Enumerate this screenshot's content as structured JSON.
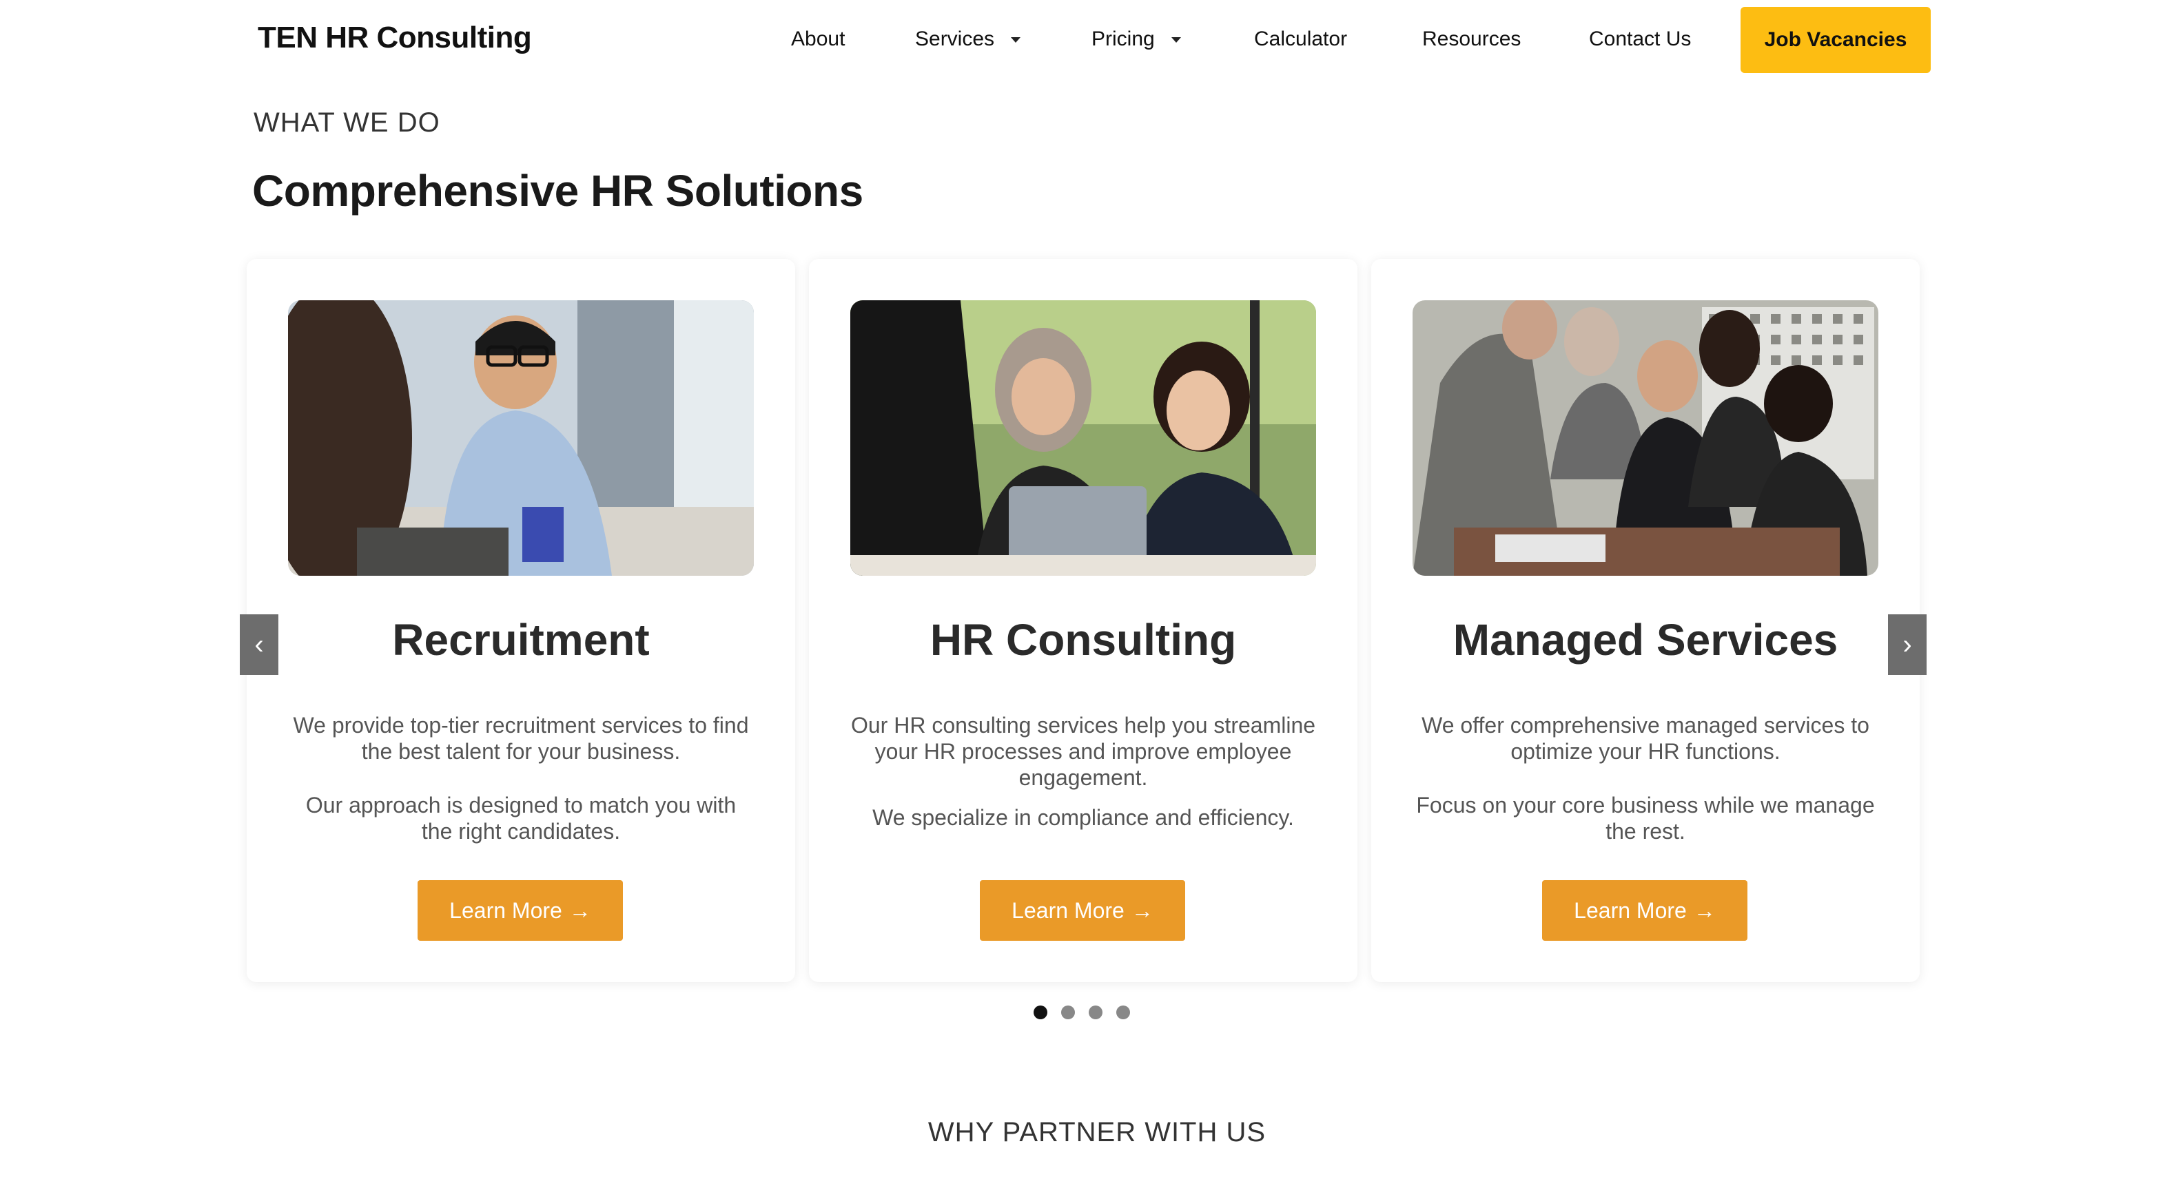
{
  "brand": "TEN HR Consulting",
  "nav": {
    "about": "About",
    "services": "Services",
    "pricing": "Pricing",
    "calculator": "Calculator",
    "resources": "Resources",
    "contact": "Contact Us",
    "job_vacancies": "Job Vacancies"
  },
  "section": {
    "eyebrow": "WHAT WE DO",
    "title": "Comprehensive HR Solutions"
  },
  "cards": [
    {
      "title": "Recruitment",
      "paragraph1": "We provide top-tier recruitment services to find the best talent for your business.",
      "paragraph2": "Our approach is designed to match you with the right candidates.",
      "button": "Learn More",
      "image": "recruitment-interview-photo"
    },
    {
      "title": "HR Consulting",
      "paragraph1": "Our HR consulting services help you streamline your HR processes and improve employee engagement.",
      "paragraph2": "We specialize in compliance and efficiency.",
      "button": "Learn More",
      "image": "hr-consulting-handshake-photo"
    },
    {
      "title": "Managed Services",
      "paragraph1": "We offer comprehensive managed services to optimize your HR functions.",
      "paragraph2": "Focus on your core business while we manage the rest.",
      "button": "Learn More",
      "image": "managed-services-team-photo"
    }
  ],
  "arrow_glyph": "→",
  "carousel": {
    "prev": "‹",
    "next": "›",
    "dots": 4,
    "active_dot": 1
  },
  "next_section": {
    "eyebrow": "WHY PARTNER WITH US"
  },
  "colors": {
    "accent_yellow": "#fdbd12",
    "accent_orange": "#ea9a28",
    "arrow_bg": "#6d6d6d"
  }
}
